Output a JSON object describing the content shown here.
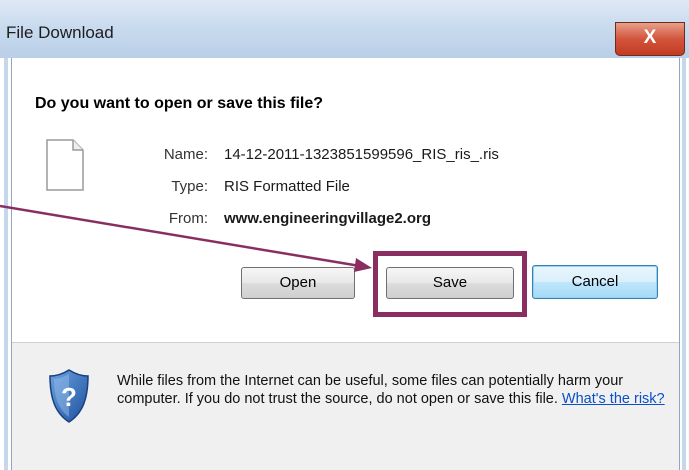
{
  "window": {
    "title": "File Download",
    "close_glyph": "X"
  },
  "dialog": {
    "question": "Do you want to open or save this file?",
    "file": {
      "name_label": "Name:",
      "name_value": "14-12-2011-1323851599596_RIS_ris_.ris",
      "type_label": "Type:",
      "type_value": "RIS Formatted File",
      "from_label": "From:",
      "from_value": "www.engineeringvillage2.org"
    },
    "buttons": {
      "open": "Open",
      "save": "Save",
      "cancel": "Cancel"
    },
    "warning": {
      "text": "While files from the Internet can be useful, some files can potentially harm your computer. If you do not trust the source, do not open or save this file.",
      "link": "What's the risk?"
    }
  },
  "icons": {
    "file": "file-icon",
    "shield": "shield-question-icon",
    "close": "close-icon"
  },
  "colors": {
    "highlight": "#8a2e62",
    "arrow": "#8a2e62",
    "link": "#0b4fc9",
    "default_button_border": "#3c7fb1"
  }
}
